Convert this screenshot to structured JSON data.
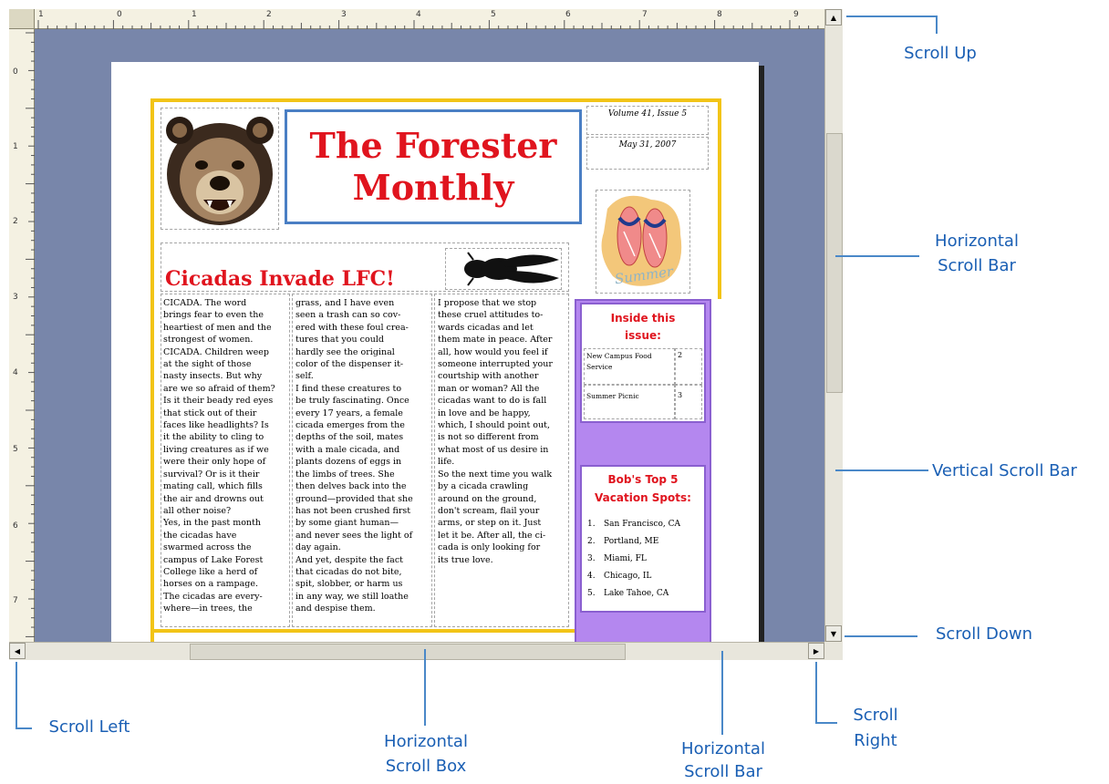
{
  "ruler": {
    "top_labels": [
      "1",
      "0",
      "1",
      "2",
      "3",
      "4",
      "5",
      "6",
      "7",
      "8",
      "9"
    ],
    "left_labels": [
      "0",
      "1",
      "2",
      "3",
      "4",
      "5",
      "6",
      "7"
    ]
  },
  "newsletter": {
    "masthead_line1": "The Forester",
    "masthead_line2": "Monthly",
    "volume": "Volume 41, Issue 5",
    "date": "May 31, 2007",
    "headline": "Cicadas Invade LFC!",
    "col1": "CICADA. The word\nbrings fear to even the\nheartiest of men and the\nstrongest of women.\nCICADA. Children weep\nat the sight of those\nnasty insects. But why\nare we so afraid of them?\nIs it their beady red eyes\nthat stick out of their\nfaces like headlights? Is\nit the ability to cling to\nliving creatures as if we\nwere their only hope of\nsurvival? Or is it their\nmating call, which fills\nthe air and drowns out\nall other noise?\nYes, in the past month\nthe cicadas have\nswarmed across the\ncampus of Lake Forest\nCollege like a herd of\nhorses on a rampage.\nThe cicadas are every-\nwhere—in trees, the",
    "col2": "grass, and I have even\nseen a trash can so cov-\nered with these foul crea-\ntures that you could\nhardly see the original\ncolor of the dispenser it-\nself.\nI find these creatures to\nbe truly fascinating. Once\nevery 17 years, a female\ncicada emerges from the\ndepths of the soil, mates\nwith a male cicada, and\nplants dozens of eggs in\nthe limbs of trees. She\nthen delves back into the\nground—provided that she\nhas not been crushed first\nby some giant human—\nand never sees the light of\nday again.\nAnd yet, despite the fact\nthat cicadas do not bite,\nspit, slobber, or harm us\nin any way, we still loathe\nand despise them.",
    "col3": "I propose that we stop\nthese cruel attitudes to-\nwards cicadas and let\nthem mate in peace. After\nall, how would you feel if\nsomeone interrupted your\ncourtship with another\nman or woman? All the\ncicadas want to do is fall\nin love and be happy,\nwhich, I should point out,\nis not so different from\nwhat most of us desire in\nlife.\nSo the next time you walk\nby a cicada crawling\naround on the ground,\ndon't scream, flail your\narms, or step on it. Just\nlet it be. After all, the ci-\ncada is only looking for\nits true love.",
    "summer_text": "Summer",
    "inside_title": "Inside this issue:",
    "inside_rows": [
      {
        "title": "New Campus Food Service",
        "page": "2"
      },
      {
        "title": "Summer Picnic",
        "page": "3"
      }
    ],
    "bobs_title": "Bob's Top 5 Vacation Spots:",
    "bobs_items": [
      {
        "num": "1.",
        "text": "San Francisco, CA"
      },
      {
        "num": "2.",
        "text": "Portland, ME"
      },
      {
        "num": "3.",
        "text": "Miami, FL"
      },
      {
        "num": "4.",
        "text": "Chicago, IL"
      },
      {
        "num": "5.",
        "text": "Lake Tahoe, CA"
      }
    ]
  },
  "callouts": {
    "scroll_up": "Scroll Up",
    "horizontal_scroll_bar_right_1": "Horizontal",
    "horizontal_scroll_bar_right_2": "Scroll Bar",
    "vertical_scroll_bar": "Vertical Scroll Bar",
    "scroll_down": "Scroll Down",
    "scroll_left": "Scroll Left",
    "horizontal_scroll_box_1": "Horizontal",
    "horizontal_scroll_box_2": "Scroll Box",
    "horizontal_scroll_bar_bottom_1": "Horizontal",
    "horizontal_scroll_bar_bottom_2": "Scroll Bar",
    "scroll_right_1": "Scroll",
    "scroll_right_2": "Right"
  },
  "colors": {
    "workspace": "#7886aa",
    "headline_red": "#e0141e",
    "purple_sidebar": "#b487ef",
    "frame_yellow": "#f2c417",
    "masthead_border": "#4a7fc4",
    "callout_blue": "#1a5fb4"
  }
}
